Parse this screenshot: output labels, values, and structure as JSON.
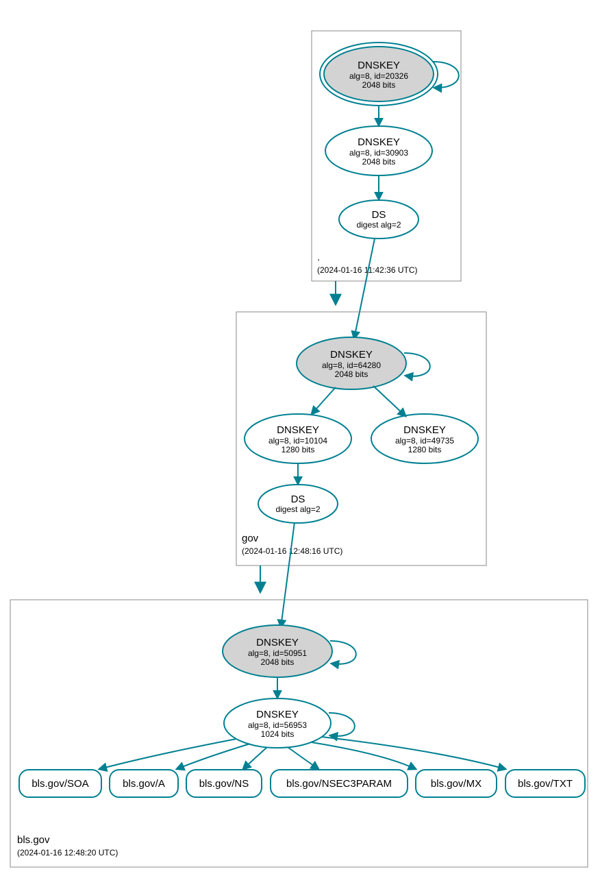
{
  "zones": {
    "root": {
      "name": ".",
      "time": "(2024-01-16 11:42:36 UTC)"
    },
    "gov": {
      "name": "gov",
      "time": "(2024-01-16 12:48:16 UTC)"
    },
    "bls": {
      "name": "bls.gov",
      "time": "(2024-01-16 12:48:20 UTC)"
    }
  },
  "nodes": {
    "root_ksk": {
      "title": "DNSKEY",
      "sub1": "alg=8, id=20326",
      "sub2": "2048 bits"
    },
    "root_zsk": {
      "title": "DNSKEY",
      "sub1": "alg=8, id=30903",
      "sub2": "2048 bits"
    },
    "root_ds": {
      "title": "DS",
      "sub1": "digest alg=2"
    },
    "gov_ksk": {
      "title": "DNSKEY",
      "sub1": "alg=8, id=64280",
      "sub2": "2048 bits"
    },
    "gov_zsk1": {
      "title": "DNSKEY",
      "sub1": "alg=8, id=10104",
      "sub2": "1280 bits"
    },
    "gov_zsk2": {
      "title": "DNSKEY",
      "sub1": "alg=8, id=49735",
      "sub2": "1280 bits"
    },
    "gov_ds": {
      "title": "DS",
      "sub1": "digest alg=2"
    },
    "bls_ksk": {
      "title": "DNSKEY",
      "sub1": "alg=8, id=50951",
      "sub2": "2048 bits"
    },
    "bls_zsk": {
      "title": "DNSKEY",
      "sub1": "alg=8, id=56953",
      "sub2": "1024 bits"
    }
  },
  "rrsets": {
    "soa": "bls.gov/SOA",
    "a": "bls.gov/A",
    "ns": "bls.gov/NS",
    "n3p": "bls.gov/NSEC3PARAM",
    "mx": "bls.gov/MX",
    "txt": "bls.gov/TXT"
  }
}
